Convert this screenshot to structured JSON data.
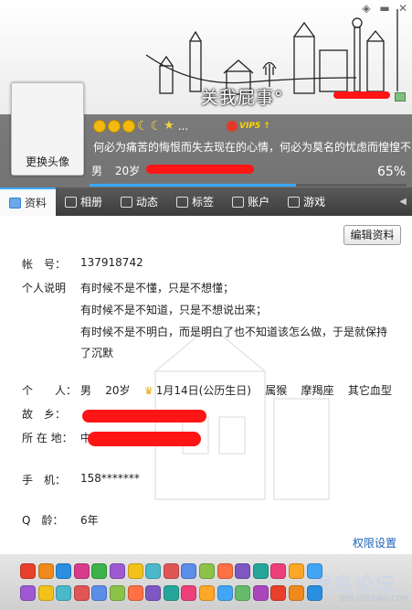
{
  "window": {
    "minimize_glyph": "▬",
    "close_glyph": "✕",
    "pin_icon": "pin-icon"
  },
  "profile": {
    "nickname": "关我屁事°",
    "avatar_button": "更换头像",
    "signature": "何必为痛苦的悔恨而失去现在的心情，何必为莫名的忧虑而惶惶不",
    "vip_label": "VIP5 ↑",
    "gender": "男",
    "age": "20岁",
    "completion": "65%",
    "completion_fraction": 0.65,
    "more_badges": "..."
  },
  "tabs": [
    {
      "label": "资料",
      "icon": "profile-card-icon",
      "active": true
    },
    {
      "label": "相册",
      "icon": "photo-icon",
      "active": false
    },
    {
      "label": "动态",
      "icon": "feed-icon",
      "active": false
    },
    {
      "label": "标签",
      "icon": "tag-icon",
      "active": false
    },
    {
      "label": "账户",
      "icon": "wallet-icon",
      "active": false
    },
    {
      "label": "游戏",
      "icon": "game-icon",
      "active": false
    }
  ],
  "tab_more_glyph": "◀",
  "detail": {
    "edit_button": "编辑资料",
    "account_label": "帐　号：",
    "account_value": "137918742",
    "desc_label": "个人说明",
    "desc_lines": [
      "有时候不是不懂，只是不想懂；",
      "有时候不是不知道，只是不想说出来；",
      "有时候不是不明白，而是明白了也不知道该怎么做，于是就保持",
      "了沉默"
    ],
    "personal_label": "个　　人：",
    "personal_gender": "男",
    "personal_age": "20岁",
    "birthday": "1月14日(公历生日)",
    "zodiac": "属猴",
    "constellation": "摩羯座",
    "blood_type": "其它血型",
    "hometown_label": "故　乡：",
    "location_label": "所 在 地：",
    "location_prefix": "中",
    "phone_label": "手　机：",
    "phone_value": "158*******",
    "age_q_label": "Q　龄：",
    "age_q_value": "6年",
    "permission_link": "权限设置"
  },
  "footer": {
    "watermark": "猴岛论坛",
    "watermark_url": "BBS.HOUDAO.COM"
  },
  "colors": {
    "accent": "#3aa8ff",
    "redacted": "#ff1515",
    "link": "#1b63b7"
  }
}
